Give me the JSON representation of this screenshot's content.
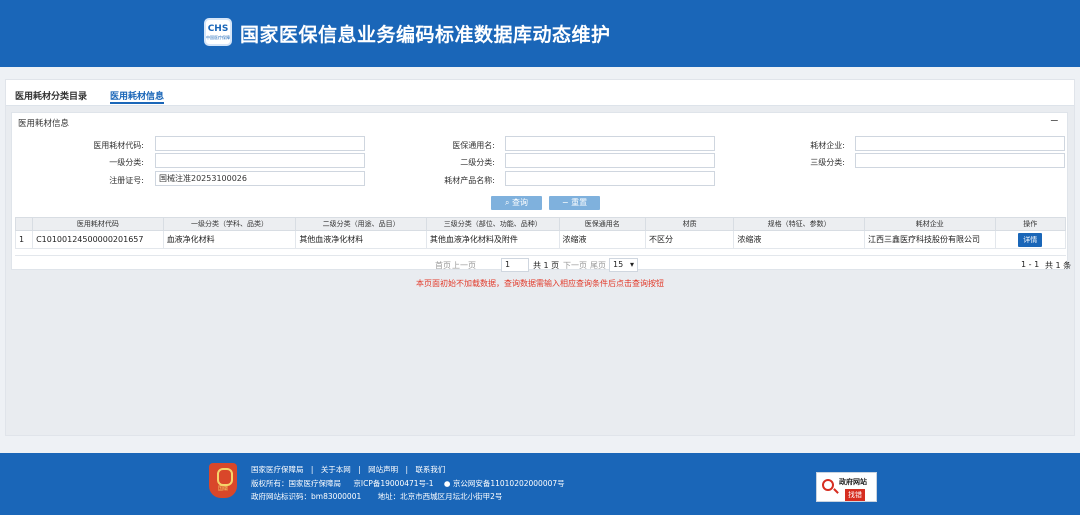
{
  "header": {
    "logo_text": "CHS",
    "logo_sub": "中国医疗保障",
    "title": "国家医保信息业务编码标准数据库动态维护"
  },
  "tabs": [
    {
      "label": "医用耗材分类目录"
    },
    {
      "label": "医用耗材信息"
    }
  ],
  "panel": {
    "title": "医用耗材信息",
    "collapse_icon": "−"
  },
  "form": {
    "code_label": "医用耗材代码:",
    "code_value": "",
    "general_name_label": "医保通用名:",
    "general_name_value": "",
    "company_label": "耗材企业:",
    "company_value": "",
    "level1_label": "一级分类:",
    "level1_value": "",
    "level2_label": "二级分类:",
    "level2_value": "",
    "level3_label": "三级分类:",
    "level3_value": "",
    "reg_label": "注册证号:",
    "reg_value": "国械注准20253100026",
    "product_label": "耗材产品名称:",
    "product_value": ""
  },
  "buttons": {
    "query": "查询",
    "reset": "重置",
    "query_icon": "search-icon",
    "reset_icon": "minus-icon"
  },
  "table": {
    "columns": [
      "",
      "医用耗材代码",
      "一级分类（学科、品类）",
      "二级分类（用途、品目）",
      "三级分类（部位、功能、品种）",
      "医保通用名",
      "材质",
      "规格（特征、参数）",
      "耗材企业",
      "操作"
    ],
    "rows": [
      {
        "index": "1",
        "code": "C10100124500000201657",
        "level1": "血液净化材料",
        "level2": "其他血液净化材料",
        "level3": "其他血液净化材料及附件",
        "general_name": "浓缩液",
        "material": "不区分",
        "spec": "浓缩液",
        "company": "江西三鑫医疗科技股份有限公司",
        "action": "详情"
      }
    ]
  },
  "pager": {
    "first": "首页",
    "prev": "上一页",
    "page": "1",
    "total_pages": "共 1 页",
    "next": "下一页",
    "last": "尾页",
    "page_size": "15",
    "range": "1 - 1",
    "total": "共 1 条"
  },
  "notice": "本页面初始不加载数据，查询数据需输入相应查询条件后点击查询按钮",
  "footer": {
    "links": [
      "国家医疗保障局",
      "关于本网",
      "网站声明",
      "联系我们"
    ],
    "copyright": "版权所有：国家医疗保障局",
    "icp": "京ICP备19000471号-1",
    "police": "京公网安备11010202000007号",
    "site_code": "政府网站标识码：bm83000001",
    "address": "地址：北京市西城区月坛北小街甲2号",
    "emblem_text": "国徽",
    "badge_title": "政府网站",
    "badge_sub": "找错"
  }
}
